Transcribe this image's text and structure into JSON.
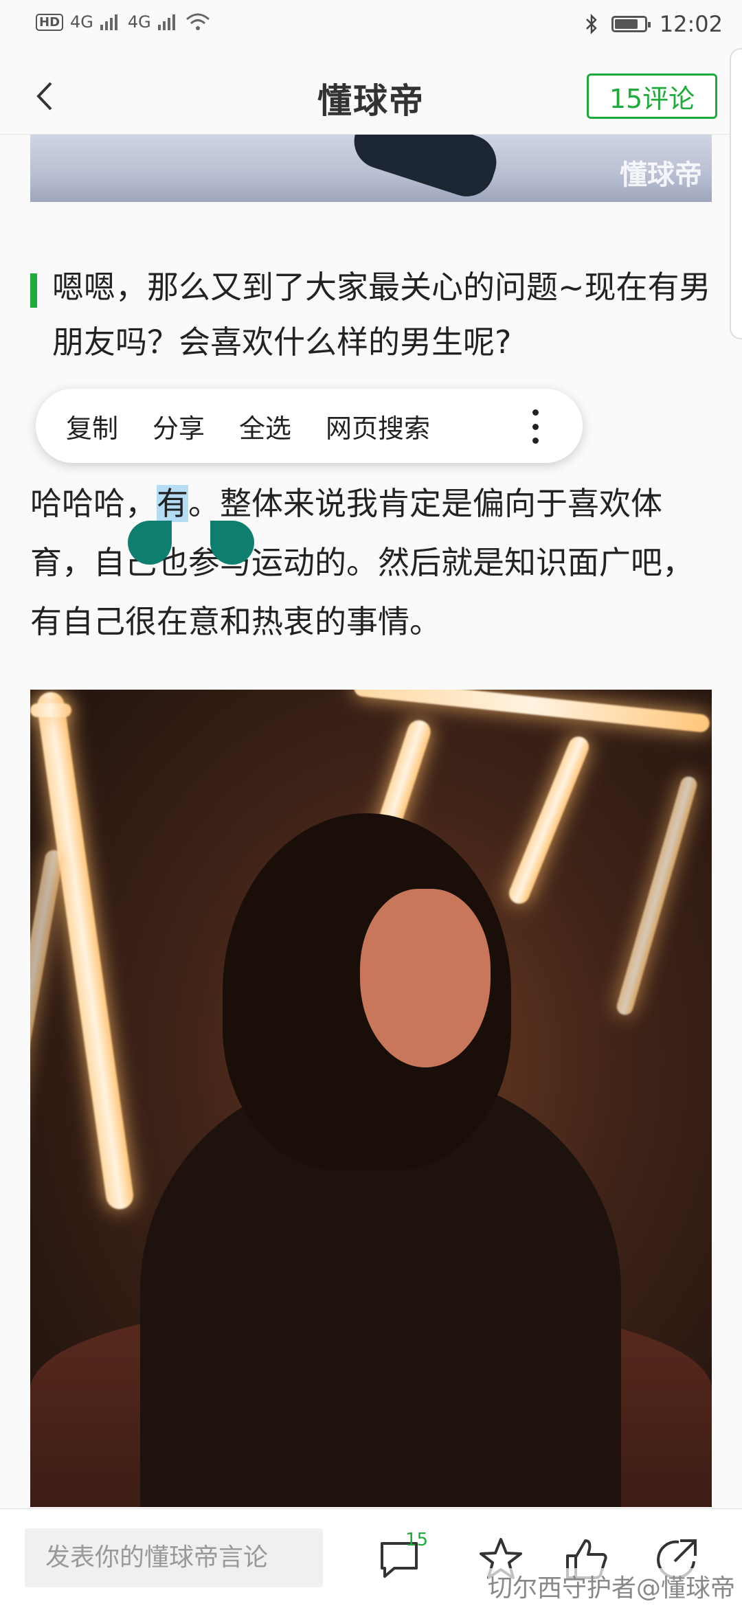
{
  "status_bar": {
    "hd": "HD",
    "net1": "4G",
    "net2": "4G",
    "time": "12:02",
    "battery_level": 0.8
  },
  "header": {
    "title": "懂球帝",
    "comment_button": "15评论"
  },
  "banner_watermark": "懂球帝",
  "question": "嗯嗯，那么又到了大家最关心的问题~现在有男朋友吗？会喜欢什么样的男生呢?",
  "selection_menu": {
    "items": [
      "复制",
      "分享",
      "全选",
      "网页搜索"
    ],
    "more_icon": "more-vertical-icon"
  },
  "answer": {
    "before": "哈哈哈，",
    "selected": "有",
    "after": "。整体来说我肯定是偏向于喜欢体育，自己也参与运动的。然后就是知识面广吧，有自己很在意和热衷的事情。"
  },
  "bottom_bar": {
    "input_placeholder": "发表你的懂球帝言论",
    "comment_count": "15",
    "icons": [
      "comment-icon",
      "star-icon",
      "thumbs-up-icon",
      "share-icon"
    ]
  },
  "watermark": "切尔西守护者@懂球帝",
  "colors": {
    "accent": "#1faa3c",
    "selection": "#b4dcf5",
    "handle": "#0e7f6f"
  }
}
